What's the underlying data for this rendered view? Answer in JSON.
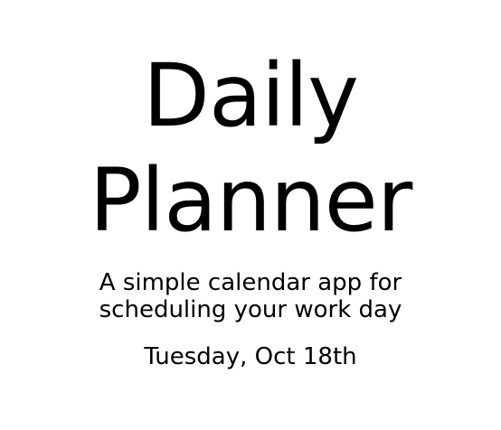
{
  "header": {
    "title_line1": "Daily",
    "title_line2": "Planner",
    "lead": "A simple calendar app for scheduling your work day",
    "current_day": "Tuesday, Oct 18th"
  },
  "colors": {
    "background": "#ffffff",
    "text": "#000000"
  }
}
